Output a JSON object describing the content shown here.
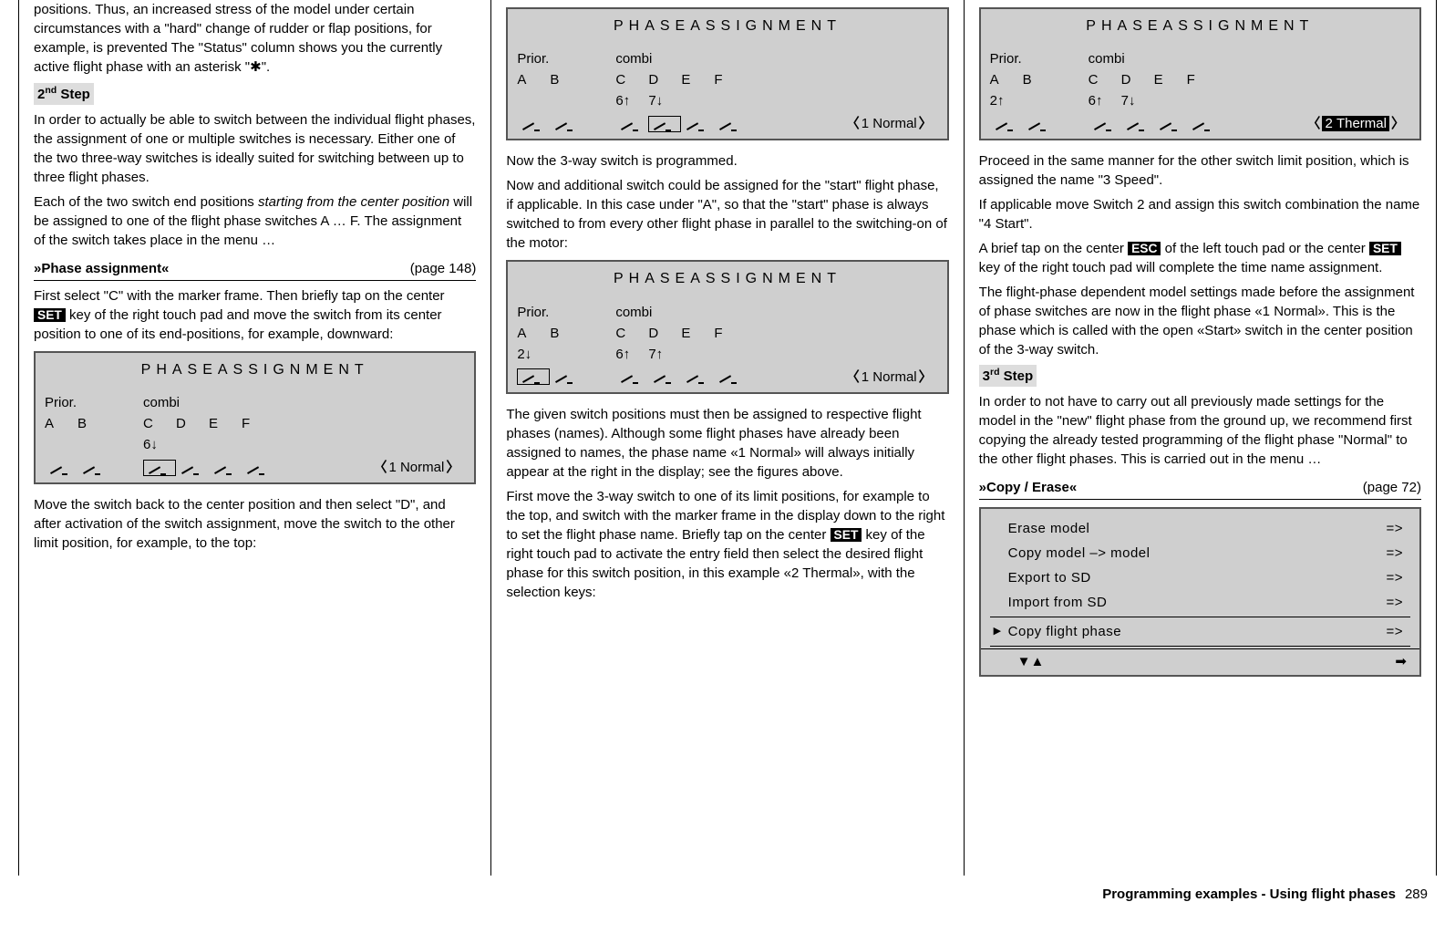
{
  "col1": {
    "p0": "positions. Thus, an increased stress of the model under certain circumstances with a \"hard\" change of rudder or flap positions, for example, is prevented The \"Status\" column shows you the currently active flight phase with an asterisk \"",
    "p0b": "\".",
    "step2": "2",
    "step2sup": "nd",
    "step2word": " Step",
    "p1": "In order to actually be able to switch between the individual flight phases, the assignment of one or multiple switches is necessary. Either one of the two three-way switches is ideally suited for switching between up to three flight phases.",
    "p2a": "Each of the two switch end positions ",
    "p2i": "starting from the center position",
    "p2b": " will be assigned to one of the flight phase switches A … F. The assignment of the switch takes place in the menu …",
    "menu1_name": "»Phase assignment«",
    "menu1_page": "(page 148)",
    "p3a": "First select \"C\" with the marker frame. Then briefly tap on the center ",
    "p3b": " key of the right touch pad and move the switch from its center position to one of its end-positions, for example, downward:",
    "p4": "Move the switch back to the center position and then select \"D\", and after activation of the switch assignment, move the switch to the other limit position, for example, to the top:"
  },
  "col2": {
    "p1": "Now the 3-way switch is programmed.",
    "p2": "Now and additional switch could be assigned for the \"start\" flight phase, if applicable. In this case under \"A\", so that the \"start\" phase is always switched to from every other flight phase in parallel to the switching-on of the motor:",
    "p3": "The given switch positions must then be assigned to respective flight phases (names). Although some flight phases have already been assigned to names, the phase name «1 Normal» will always initially appear at the right in the display; see the figures above.",
    "p4a": "First move the 3-way switch to one of its limit positions, for example to the top, and switch with the marker frame in the display down to the right to set the flight phase name. Briefly tap on the center ",
    "p4b": " key of the right touch pad to activate the entry field then select the desired flight phase for this switch position, in this example «2 Thermal», with the selection keys:"
  },
  "col3": {
    "p1": "Proceed in the same manner for the other switch limit position, which is assigned the name \"3 Speed\".",
    "p2": "If applicable move Switch 2 and assign this switch combination the name \"4 Start\".",
    "p3a": "A brief tap on the center ",
    "p3b": " of the left touch pad or the center ",
    "p3c": " key of the right touch pad will complete the time name assignment.",
    "p4": "The flight-phase dependent model settings made before the assignment of phase switches are now in the flight phase «1 Normal». This is the phase which is called with the open «Start» switch in the center position of the 3-way switch.",
    "step3": "3",
    "step3sup": "rd",
    "step3word": " Step",
    "p5": "In order to not have to carry out all previously made settings for the model in the \"new\" flight phase from the ground up, we recommend first copying the already tested programming of the flight phase \"Normal\" to the other flight phases. This is carried out in the menu …",
    "menu2_name": "»Copy / Erase«",
    "menu2_page": "(page 72)"
  },
  "keys": {
    "set": "SET",
    "esc": "ESC"
  },
  "screen": {
    "title": "PHASEASSIGNMENT",
    "prior": "Prior.",
    "combi": "combi",
    "cols": {
      "a": "A",
      "b": "B",
      "c": "C",
      "d": "D",
      "e": "E",
      "f": "F"
    },
    "v6up": "6↑",
    "v6dn": "6↓",
    "v7up": "7↑",
    "v7dn": "7↓",
    "v2up": "2↑",
    "v2dn": "2↓",
    "normal": "1 Normal",
    "thermal": "2 Thermal"
  },
  "copy": {
    "r1": "Erase model",
    "r2": "Copy model –> model",
    "r3": "Export to SD",
    "r4": "Import from SD",
    "r5": "Copy flight phase",
    "arrow": "=>"
  },
  "footer": {
    "title": "Programming examples - Using flight phases",
    "page": "289"
  },
  "glyph": {
    "star": "✱",
    "updown": "▼▲",
    "right": "➡"
  }
}
